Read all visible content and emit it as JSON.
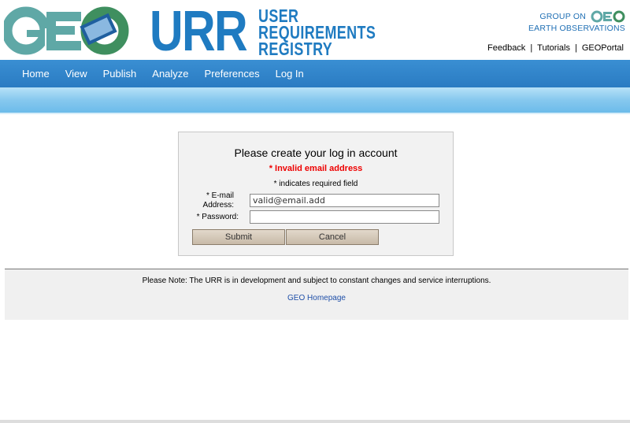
{
  "header": {
    "geo_logo_text": "GEO",
    "urr_logo_big": "URR",
    "urr_logo_words": [
      "USER",
      "REQUIREMENTS",
      "REGISTRY"
    ],
    "group_line1": "GROUP ON",
    "group_line2": "EARTH OBSERVATIONS",
    "group_mini": "GEO",
    "links": [
      {
        "label": "Feedback"
      },
      {
        "label": "Tutorials"
      },
      {
        "label": "GEOPortal"
      }
    ],
    "separator": "|"
  },
  "nav": {
    "items": [
      {
        "label": "Home"
      },
      {
        "label": "View"
      },
      {
        "label": "Publish"
      },
      {
        "label": "Analyze"
      },
      {
        "label": "Preferences"
      },
      {
        "label": "Log In"
      }
    ]
  },
  "login": {
    "title": "Please create your log in account",
    "error": "* Invalid email address",
    "required_note": "* indicates required field",
    "email_label": "* E-mail Address:",
    "email_value": "valid@email.add",
    "password_label": "* Password:",
    "submit_label": "Submit",
    "cancel_label": "Cancel"
  },
  "notice": {
    "text": "Please Note: The URR is in development and subject to constant changes and service interruptions.",
    "home_link": "GEO Homepage"
  },
  "colors": {
    "brand_blue": "#1f7bc1",
    "nav_blue": "#2a7bc2",
    "error_red": "#e00000"
  }
}
